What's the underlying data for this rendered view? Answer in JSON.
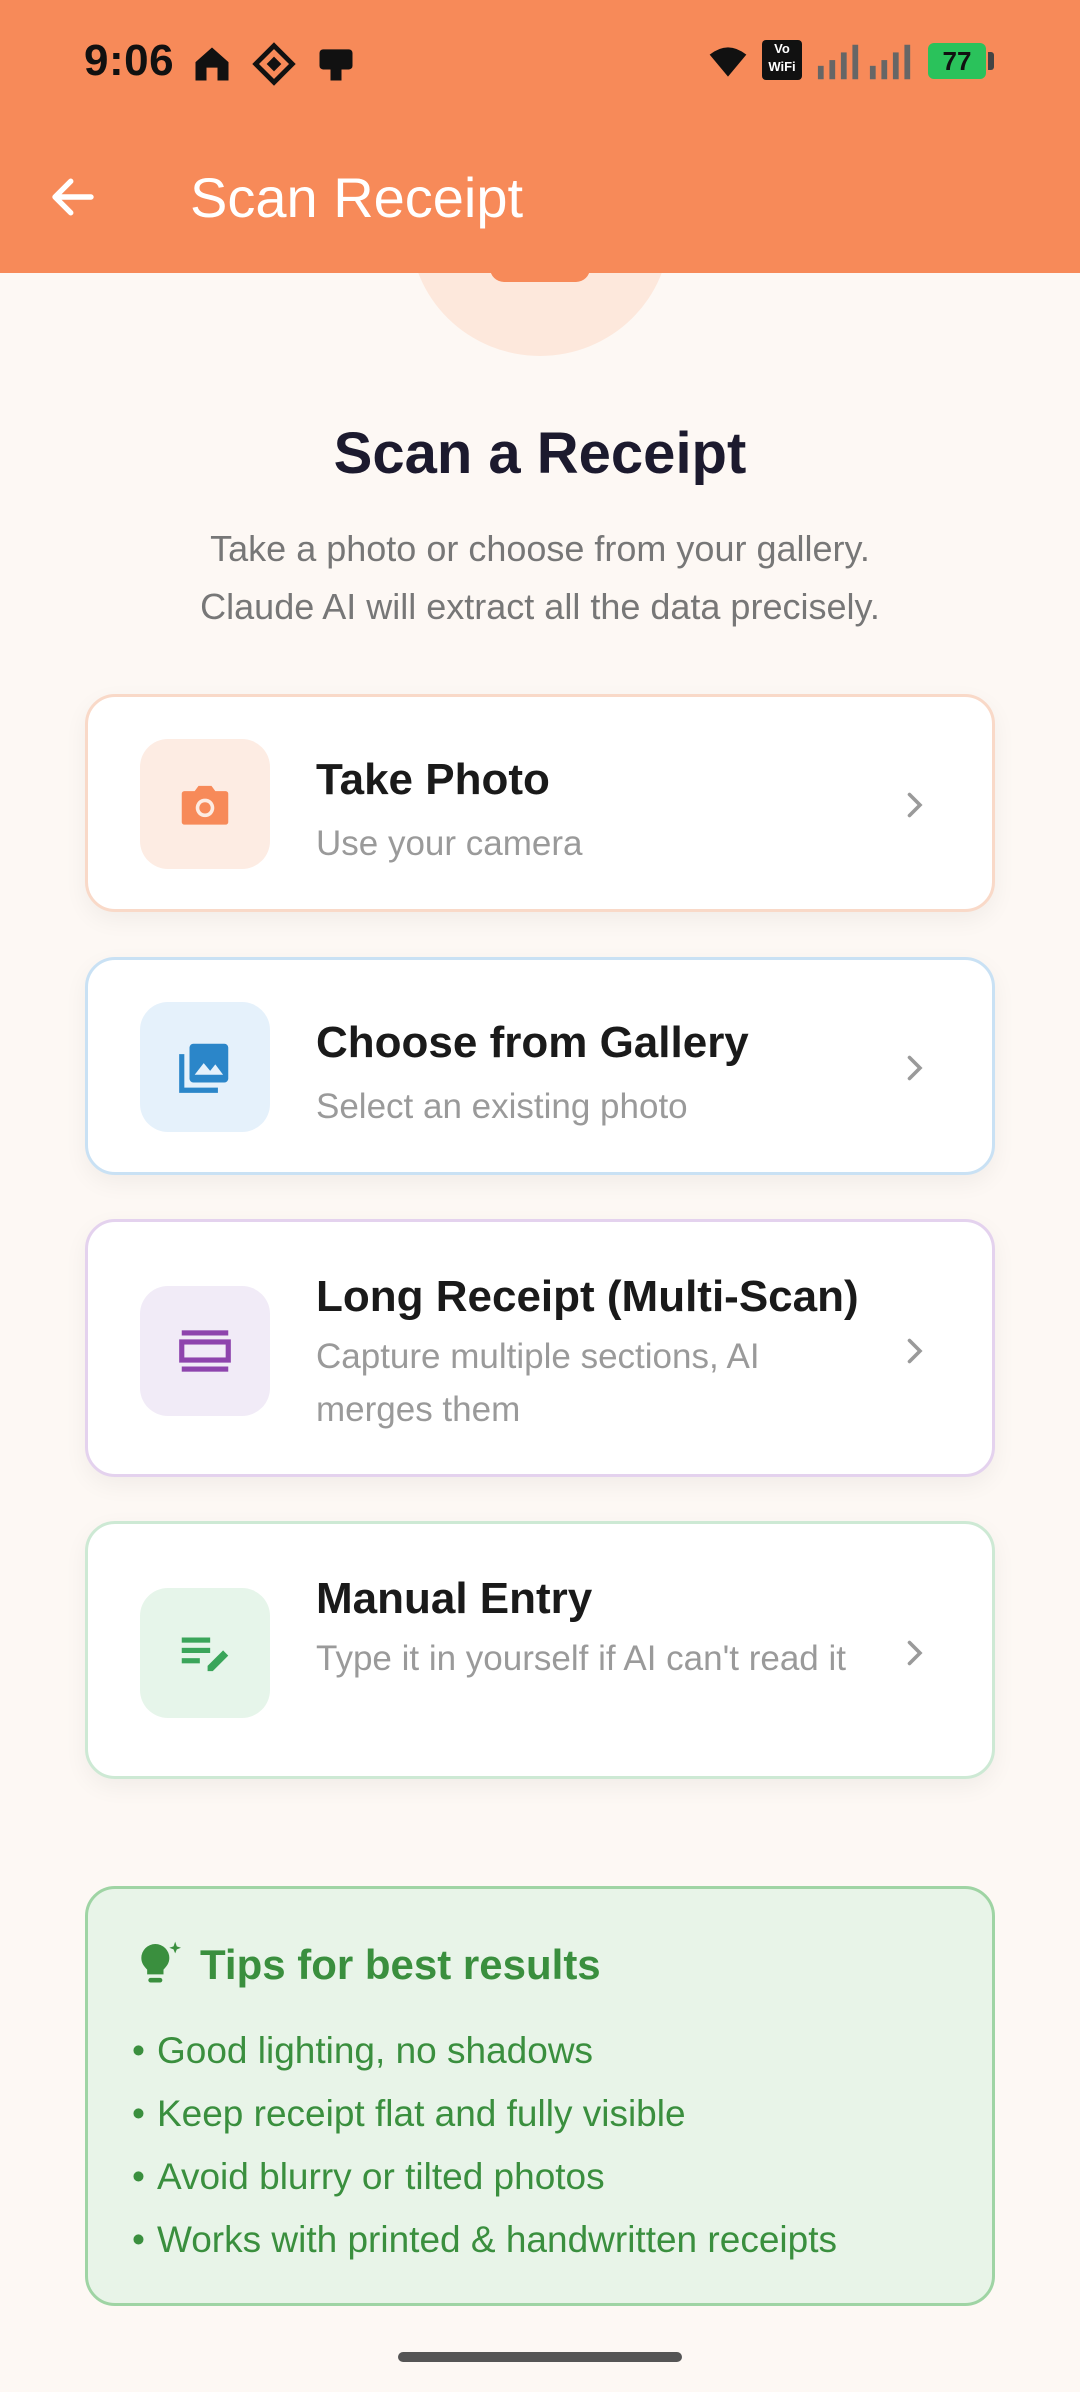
{
  "status_bar": {
    "time": "9:06",
    "battery": "77",
    "vowifi": "Vo WiFi"
  },
  "app_bar": {
    "title": "Scan Receipt",
    "back_icon": "arrow-back-icon"
  },
  "main": {
    "heading": "Scan a Receipt",
    "subtitle_line1": "Take a photo or choose from your gallery.",
    "subtitle_line2": "Claude AI will extract all the data precisely.",
    "options": [
      {
        "title": "Take Photo",
        "desc": "Use your camera",
        "icon": "camera-icon",
        "color": "#f78a59",
        "bg": "#fdece3",
        "border": "#f9d9c8"
      },
      {
        "title": "Choose from Gallery",
        "desc": "Select an existing photo",
        "icon": "gallery-icon",
        "color": "#2b86c9",
        "bg": "#e5f1fb",
        "border": "#c9e1f4"
      },
      {
        "title": "Long Receipt (Multi-Scan)",
        "desc": "Capture multiple sections, AI merges them",
        "icon": "multi-scan-icon",
        "color": "#8e44ad",
        "bg": "#f1ebf7",
        "border": "#e4d2ee"
      },
      {
        "title": "Manual Entry",
        "desc": "Type it in yourself if AI can't read it",
        "icon": "edit-note-icon",
        "color": "#3aa55a",
        "bg": "#e6f5ea",
        "border": "#cde9d4"
      }
    ]
  },
  "tips": {
    "title": "Tips for best results",
    "items": [
      "Good lighting, no shadows",
      "Keep receipt flat and fully visible",
      "Avoid blurry or tilted photos",
      "Works with printed & handwritten receipts"
    ]
  }
}
